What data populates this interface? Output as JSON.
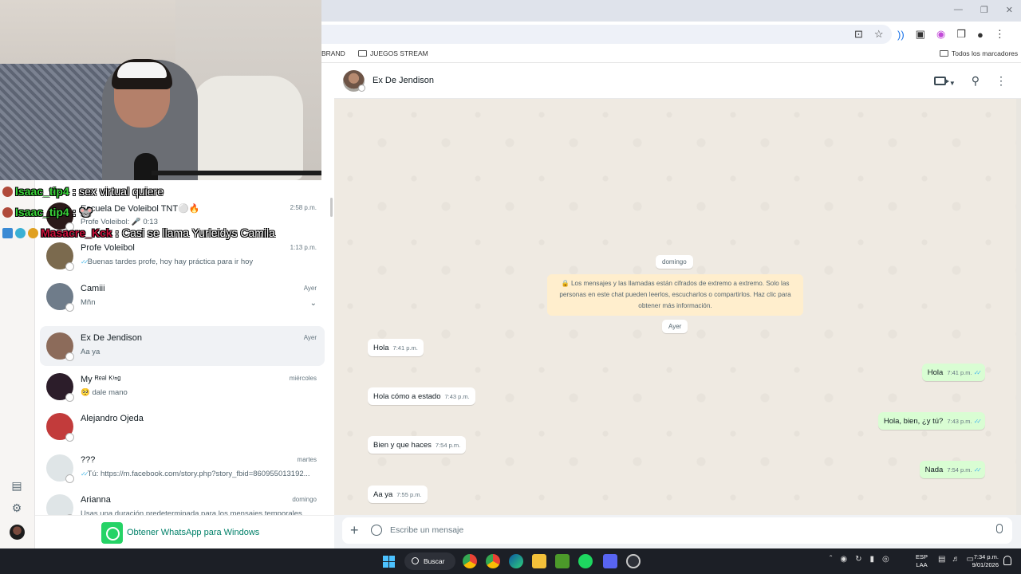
{
  "browser": {
    "bookmarks": [
      {
        "label": "BRAND"
      },
      {
        "label": "JUEGOS STREAM"
      }
    ],
    "all_bookmarks": "Todos los marcadores"
  },
  "overlay_chat": [
    {
      "user": "Isaac_tip4",
      "message": "sex virtual quiere",
      "user_color": "#3ad43a"
    },
    {
      "user": "Isaac_tip4",
      "message": "🐭",
      "user_color": "#3ad43a"
    },
    {
      "user": "Masacre_Kck",
      "message": "Casi se llama Yurleidys Camila",
      "user_color": "#c8103a"
    }
  ],
  "chat_list": [
    {
      "name": "Escuela De Voleibol TNT⚪🔥",
      "time": "2:58 p.m.",
      "message": "Profe Voleibol: 🎤 0:13",
      "avatar_color": "#2b1a1a"
    },
    {
      "name": "Profe Voleibol",
      "time": "1:13 p.m.",
      "message": "Buenas tardes profe, hoy hay práctica para ir hoy",
      "ticks": true,
      "avatar_color": "#7b6a4e"
    },
    {
      "name": "Camiii",
      "time": "Ayer",
      "message": "Mñn",
      "avatar_color": "#6f7c8a",
      "chevron": true
    },
    {
      "name": "Ex De Jendison",
      "time": "Ayer",
      "message": "Aa ya",
      "avatar_color": "#8c6b5a",
      "active": true
    },
    {
      "name": "My ᴿᵉᵃˡ ᴷⁱⁿᵍ",
      "time": "miércoles",
      "message": "🥺 dale mano",
      "avatar_color": "#2c1d2a"
    },
    {
      "name": "Alejandro Ojeda",
      "time": "",
      "message": "",
      "avatar_color": "#c23b3b"
    },
    {
      "name": "???",
      "time": "martes",
      "message": "Tú: https://m.facebook.com/story.php?story_fbid=860955013192...",
      "ticks": true,
      "avatar_color": "#dfe5e7"
    },
    {
      "name": "Arianna",
      "time": "domingo",
      "message": "Usas una duración predeterminada para los mensajes temporales en...",
      "avatar_color": "#dfe5e7"
    }
  ],
  "get_whatsapp": "Obtener WhatsApp para Windows",
  "conversation": {
    "name": "Ex De Jendison",
    "day_labels": [
      "domingo",
      "Ayer"
    ],
    "encryption_note": "🔒 Los mensajes y las llamadas están cifrados de extremo a extremo. Solo las personas en este chat pueden leerlos, escucharlos o compartirlos. Haz clic para obtener más información.",
    "messages": [
      {
        "dir": "in",
        "text": "Hola",
        "time": "7:41 p.m."
      },
      {
        "dir": "out",
        "text": "Hola",
        "time": "7:41 p.m."
      },
      {
        "dir": "in",
        "text": "Hola cómo a estado",
        "time": "7:43 p.m."
      },
      {
        "dir": "out",
        "text": "Hola, bien, ¿y tú?",
        "time": "7:43 p.m."
      },
      {
        "dir": "in",
        "text": "Bien y que haces",
        "time": "7:54 p.m."
      },
      {
        "dir": "out",
        "text": "Nada",
        "time": "7:54 p.m."
      },
      {
        "dir": "in",
        "text": "Aa ya",
        "time": "7:55 p.m."
      }
    ],
    "compose_placeholder": "Escribe un mensaje"
  },
  "taskbar": {
    "search_label": "Buscar",
    "lang_line1": "ESP",
    "lang_line2": "LAA",
    "time": "7:34 p.m.",
    "date": "9/01/2026"
  }
}
